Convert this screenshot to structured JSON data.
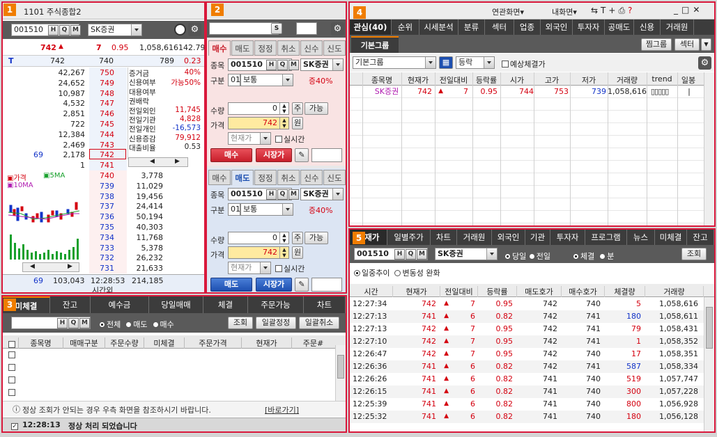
{
  "p1": {
    "num": "1",
    "title": "1101 주식종합2",
    "code": "001510",
    "name": "SK증권",
    "price": "742",
    "arrow": "▲",
    "change": "7",
    "rate": "0.95",
    "volume": "1,058,616",
    "pct": "142.79",
    "sub_T": "T",
    "sub_742": "742",
    "sub_740": "740",
    "sub_789": "789",
    "sub_023": "0.23",
    "asks": [
      [
        "42,267",
        "750"
      ],
      [
        "24,652",
        "749"
      ],
      [
        "10,987",
        "748"
      ],
      [
        "4,532",
        "747"
      ],
      [
        "2,851",
        "746"
      ],
      [
        "722",
        "745"
      ],
      [
        "12,384",
        "744"
      ],
      [
        "2,469",
        "743"
      ],
      [
        "2,178",
        "742"
      ],
      [
        "1",
        "741"
      ]
    ],
    "ask_left": "69",
    "bids": [
      [
        "740",
        "3,778"
      ],
      [
        "739",
        "11,029"
      ],
      [
        "738",
        "19,456"
      ],
      [
        "737",
        "24,414"
      ],
      [
        "736",
        "50,194"
      ],
      [
        "735",
        "40,303"
      ],
      [
        "734",
        "11,768"
      ],
      [
        "733",
        "5,378"
      ],
      [
        "732",
        "26,232"
      ],
      [
        "731",
        "21,633"
      ]
    ],
    "info": [
      [
        "증거금",
        "40%"
      ],
      [
        "신용여부",
        "가능50%"
      ],
      [
        "대용여부",
        ""
      ],
      [
        "권배락",
        ""
      ],
      [
        "전일외인",
        "11,745"
      ],
      [
        "전일기관",
        "4,828"
      ],
      [
        "전일개인",
        "-16,573"
      ],
      [
        "신용증감",
        "79,912"
      ],
      [
        "대출비율",
        "0.53"
      ]
    ],
    "legend1": "가격",
    "legend2": "5MA",
    "legend3": "10MA",
    "foot_left": "69",
    "foot_ask": "103,043",
    "foot_time": "12:28:53",
    "foot_time_label": "시간외",
    "foot_bid": "214,185"
  },
  "p2": {
    "num": "2",
    "s_btn": "S",
    "tabs": [
      "매수",
      "매도",
      "정정",
      "취소",
      "신수",
      "신도"
    ],
    "buy": {
      "code_label": "종목",
      "code": "001510",
      "name": "SK증권",
      "type_label": "구분",
      "type_code": "01",
      "type": "보통",
      "margin": "증40%",
      "qty_label": "수량",
      "qty": "0",
      "ju": "주",
      "avail": "가능",
      "price_label": "가격",
      "price": "742",
      "won": "원",
      "cur": "현재가",
      "realtime": "실시간",
      "action": "매수",
      "market": "시장가"
    },
    "sell": {
      "code_label": "종목",
      "code": "001510",
      "name": "SK증권",
      "type_label": "구분",
      "type_code": "01",
      "type": "보통",
      "margin": "증40%",
      "qty_label": "수량",
      "qty": "0",
      "ju": "주",
      "avail": "가능",
      "price_label": "가격",
      "price": "742",
      "won": "원",
      "cur": "현재가",
      "realtime": "실시간",
      "action": "매도",
      "market": "시장가"
    }
  },
  "p3": {
    "num": "3",
    "tabs": [
      "미체결",
      "잔고",
      "예수금",
      "당일매매",
      "체결",
      "주문가능",
      "차트"
    ],
    "radio": [
      "전체",
      "매도",
      "매수"
    ],
    "btn_query": "조회",
    "btn_mod": "일괄정정",
    "btn_cancel": "일괄취소",
    "cols": [
      "종목명",
      "매매구분",
      "주문수량",
      "미체결",
      "주문가격",
      "현재가",
      "주문#"
    ],
    "notice": "정상 조회가 안되는 경우 우측 화면을 참조하시기 바랍니다.",
    "notice_link": "[바로가기]",
    "status_time": "12:28:13",
    "status_msg": "정상 처리 되었습니다"
  },
  "p4": {
    "num": "4",
    "top_links": [
      "연관화면▾",
      "내화면▾"
    ],
    "tabs": [
      "관심(40)",
      "순위",
      "시세분석",
      "분류",
      "섹터",
      "업종",
      "외국인",
      "투자자",
      "공매도",
      "신용",
      "거래원"
    ],
    "group_tab": "기본그룹",
    "btn_group": "찜그룹",
    "btn_sector": "섹터",
    "group_sel": "기본그룹",
    "sort_sel": "등락",
    "expect": "예상체결가",
    "cols": [
      "종목명",
      "현재가",
      "전일대비",
      "등락률",
      "시가",
      "고가",
      "저가",
      "거래량",
      "trend",
      "일봉"
    ],
    "row": {
      "name": "SK증권",
      "price": "742",
      "arrow": "▲",
      "change": "7",
      "rate": "0.95",
      "open": "744",
      "high": "753",
      "low": "739",
      "volume": "1,058,616"
    }
  },
  "p5": {
    "num": "5",
    "tabs": [
      "현재가",
      "일별주가",
      "차트",
      "거래원",
      "외국인",
      "기관",
      "투자자",
      "프로그램",
      "뉴스",
      "미체결",
      "잔고"
    ],
    "code": "001510",
    "name": "SK증권",
    "r1": [
      "당일",
      "전일"
    ],
    "r2": [
      "체결",
      "분"
    ],
    "btn_query": "조회",
    "r3": [
      "일중추이",
      "변동성 완화"
    ],
    "cols": [
      "시간",
      "현재가",
      "전일대비",
      "등락률",
      "매도호가",
      "매수호가",
      "체결량",
      "거래량"
    ],
    "rows": [
      [
        "12:27:34",
        "742",
        "▲",
        "7",
        "0.95",
        "742",
        "740",
        "5",
        "1,058,616",
        "r"
      ],
      [
        "12:27:13",
        "741",
        "▲",
        "6",
        "0.82",
        "742",
        "741",
        "180",
        "1,058,611",
        "b"
      ],
      [
        "12:27:13",
        "742",
        "▲",
        "7",
        "0.95",
        "742",
        "741",
        "79",
        "1,058,431",
        "r"
      ],
      [
        "12:27:10",
        "742",
        "▲",
        "7",
        "0.95",
        "742",
        "741",
        "1",
        "1,058,352",
        "r"
      ],
      [
        "12:26:47",
        "742",
        "▲",
        "7",
        "0.95",
        "742",
        "740",
        "17",
        "1,058,351",
        "r"
      ],
      [
        "12:26:36",
        "741",
        "▲",
        "6",
        "0.82",
        "742",
        "741",
        "587",
        "1,058,334",
        "b"
      ],
      [
        "12:26:26",
        "741",
        "▲",
        "6",
        "0.82",
        "741",
        "740",
        "519",
        "1,057,747",
        "r"
      ],
      [
        "12:26:15",
        "741",
        "▲",
        "6",
        "0.82",
        "741",
        "740",
        "300",
        "1,057,228",
        "r"
      ],
      [
        "12:25:39",
        "741",
        "▲",
        "6",
        "0.82",
        "741",
        "740",
        "800",
        "1,056,928",
        "r"
      ],
      [
        "12:25:32",
        "741",
        "▲",
        "6",
        "0.82",
        "741",
        "740",
        "180",
        "1,056,128",
        "r"
      ]
    ]
  }
}
